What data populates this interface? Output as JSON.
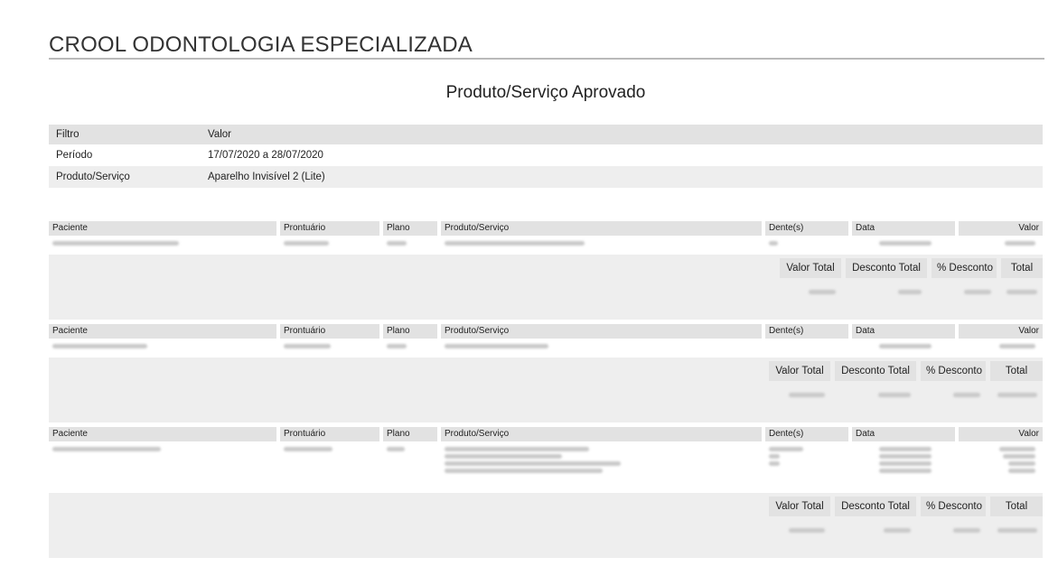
{
  "company_title": "CROOL ODONTOLOGIA ESPECIALIZADA",
  "report_title": "Produto/Serviço Aprovado",
  "filters": {
    "header": {
      "col1": "Filtro",
      "col2": "Valor"
    },
    "rows": [
      {
        "label": "Período",
        "value": "17/07/2020 a 28/07/2020"
      },
      {
        "label": "Produto/Serviço",
        "value": "Aparelho Invisível 2 (Lite)"
      }
    ]
  },
  "record_headers": {
    "paciente": "Paciente",
    "prontuario": "Prontuário",
    "plano": "Plano",
    "produto_servico": "Produto/Serviço",
    "dentes": "Dente(s)",
    "data": "Data",
    "valor": "Valor"
  },
  "totals_headers": {
    "valor_total": "Valor Total",
    "desconto_total": "Desconto Total",
    "pct_desconto": "% Desconto",
    "total": "Total"
  }
}
